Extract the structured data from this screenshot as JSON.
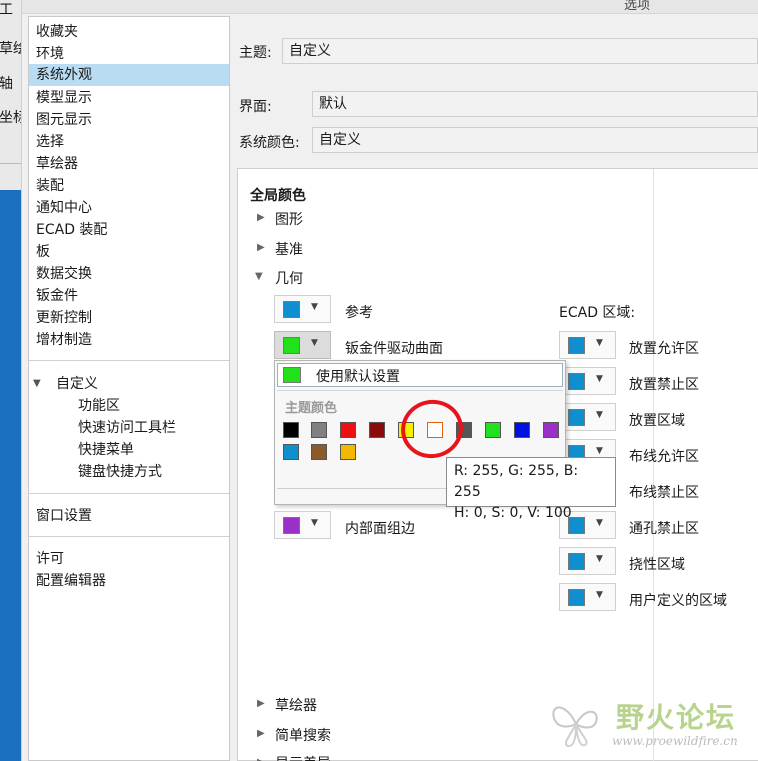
{
  "app_strip": {
    "labels": [
      "工",
      "草绘",
      "轴",
      "坐标"
    ]
  },
  "window": {
    "title": "选项"
  },
  "nav": {
    "items": [
      "收藏夹",
      "环境",
      "系统外观",
      "模型显示",
      "图元显示",
      "选择",
      "草绘器",
      "装配",
      "通知中心",
      "ECAD 装配",
      "板",
      "数据交换",
      "钣金件",
      "更新控制",
      "增材制造"
    ],
    "selected": "系统外观",
    "custom_group": {
      "label": "自定义",
      "children": [
        "功能区",
        "快速访问工具栏",
        "快捷菜单",
        "键盘快捷方式"
      ]
    },
    "window_settings": "窗口设置",
    "footer": [
      "许可",
      "配置编辑器"
    ]
  },
  "form": {
    "theme_label": "主题:",
    "theme_value": "自定义",
    "interface_label": "界面:",
    "interface_value": "默认",
    "syscolor_label": "系统颜色:",
    "syscolor_value": "自定义"
  },
  "global_colors": {
    "title": "全局颜色",
    "collapsed": [
      "图形",
      "基准"
    ],
    "expanded": "几何",
    "left_items": [
      {
        "label": "参考",
        "color": "#0f8fcf"
      },
      {
        "label": "钣金件驱动曲面",
        "color": "#22e01a"
      },
      {
        "label": "内部面组边",
        "color": "#9a30c8"
      }
    ],
    "ecad_title": "ECAD 区域:",
    "ecad_items": [
      {
        "label": "放置允许区",
        "color": "#0f8fcf"
      },
      {
        "label": "放置禁止区",
        "color": "#0f8fcf"
      },
      {
        "label": "放置区域",
        "color": "#0f8fcf"
      },
      {
        "label": "布线允许区",
        "color": "#0f8fcf"
      },
      {
        "label": "布线禁止区",
        "color": "#0f8fcf"
      },
      {
        "label": "通孔禁止区",
        "color": "#0f8fcf"
      },
      {
        "label": "挠性区域",
        "color": "#0f8fcf"
      },
      {
        "label": "用户定义的区域",
        "color": "#0f8fcf"
      }
    ],
    "bottom_sections": [
      "草绘器",
      "简单搜索",
      "显示差异"
    ]
  },
  "popup": {
    "default_label": "使用默认设置",
    "default_color": "#22e01a",
    "theme_colors_label": "主题颜色",
    "palette": [
      "#000000",
      "#808080",
      "#ee1010",
      "#8b0b0b",
      "#f2f200",
      "#ffffff",
      "#555555",
      "#20e020",
      "#0010e0",
      "#9a30c8",
      "#0f8fcf",
      "#8b5a2b",
      "#f0b800"
    ]
  },
  "tooltip": {
    "line1": "R: 255, G: 255, B: 255",
    "line2": "H: 0, S: 0, V: 100"
  },
  "watermark": {
    "text": "野火论坛",
    "url": "www.proewildfire.cn"
  }
}
